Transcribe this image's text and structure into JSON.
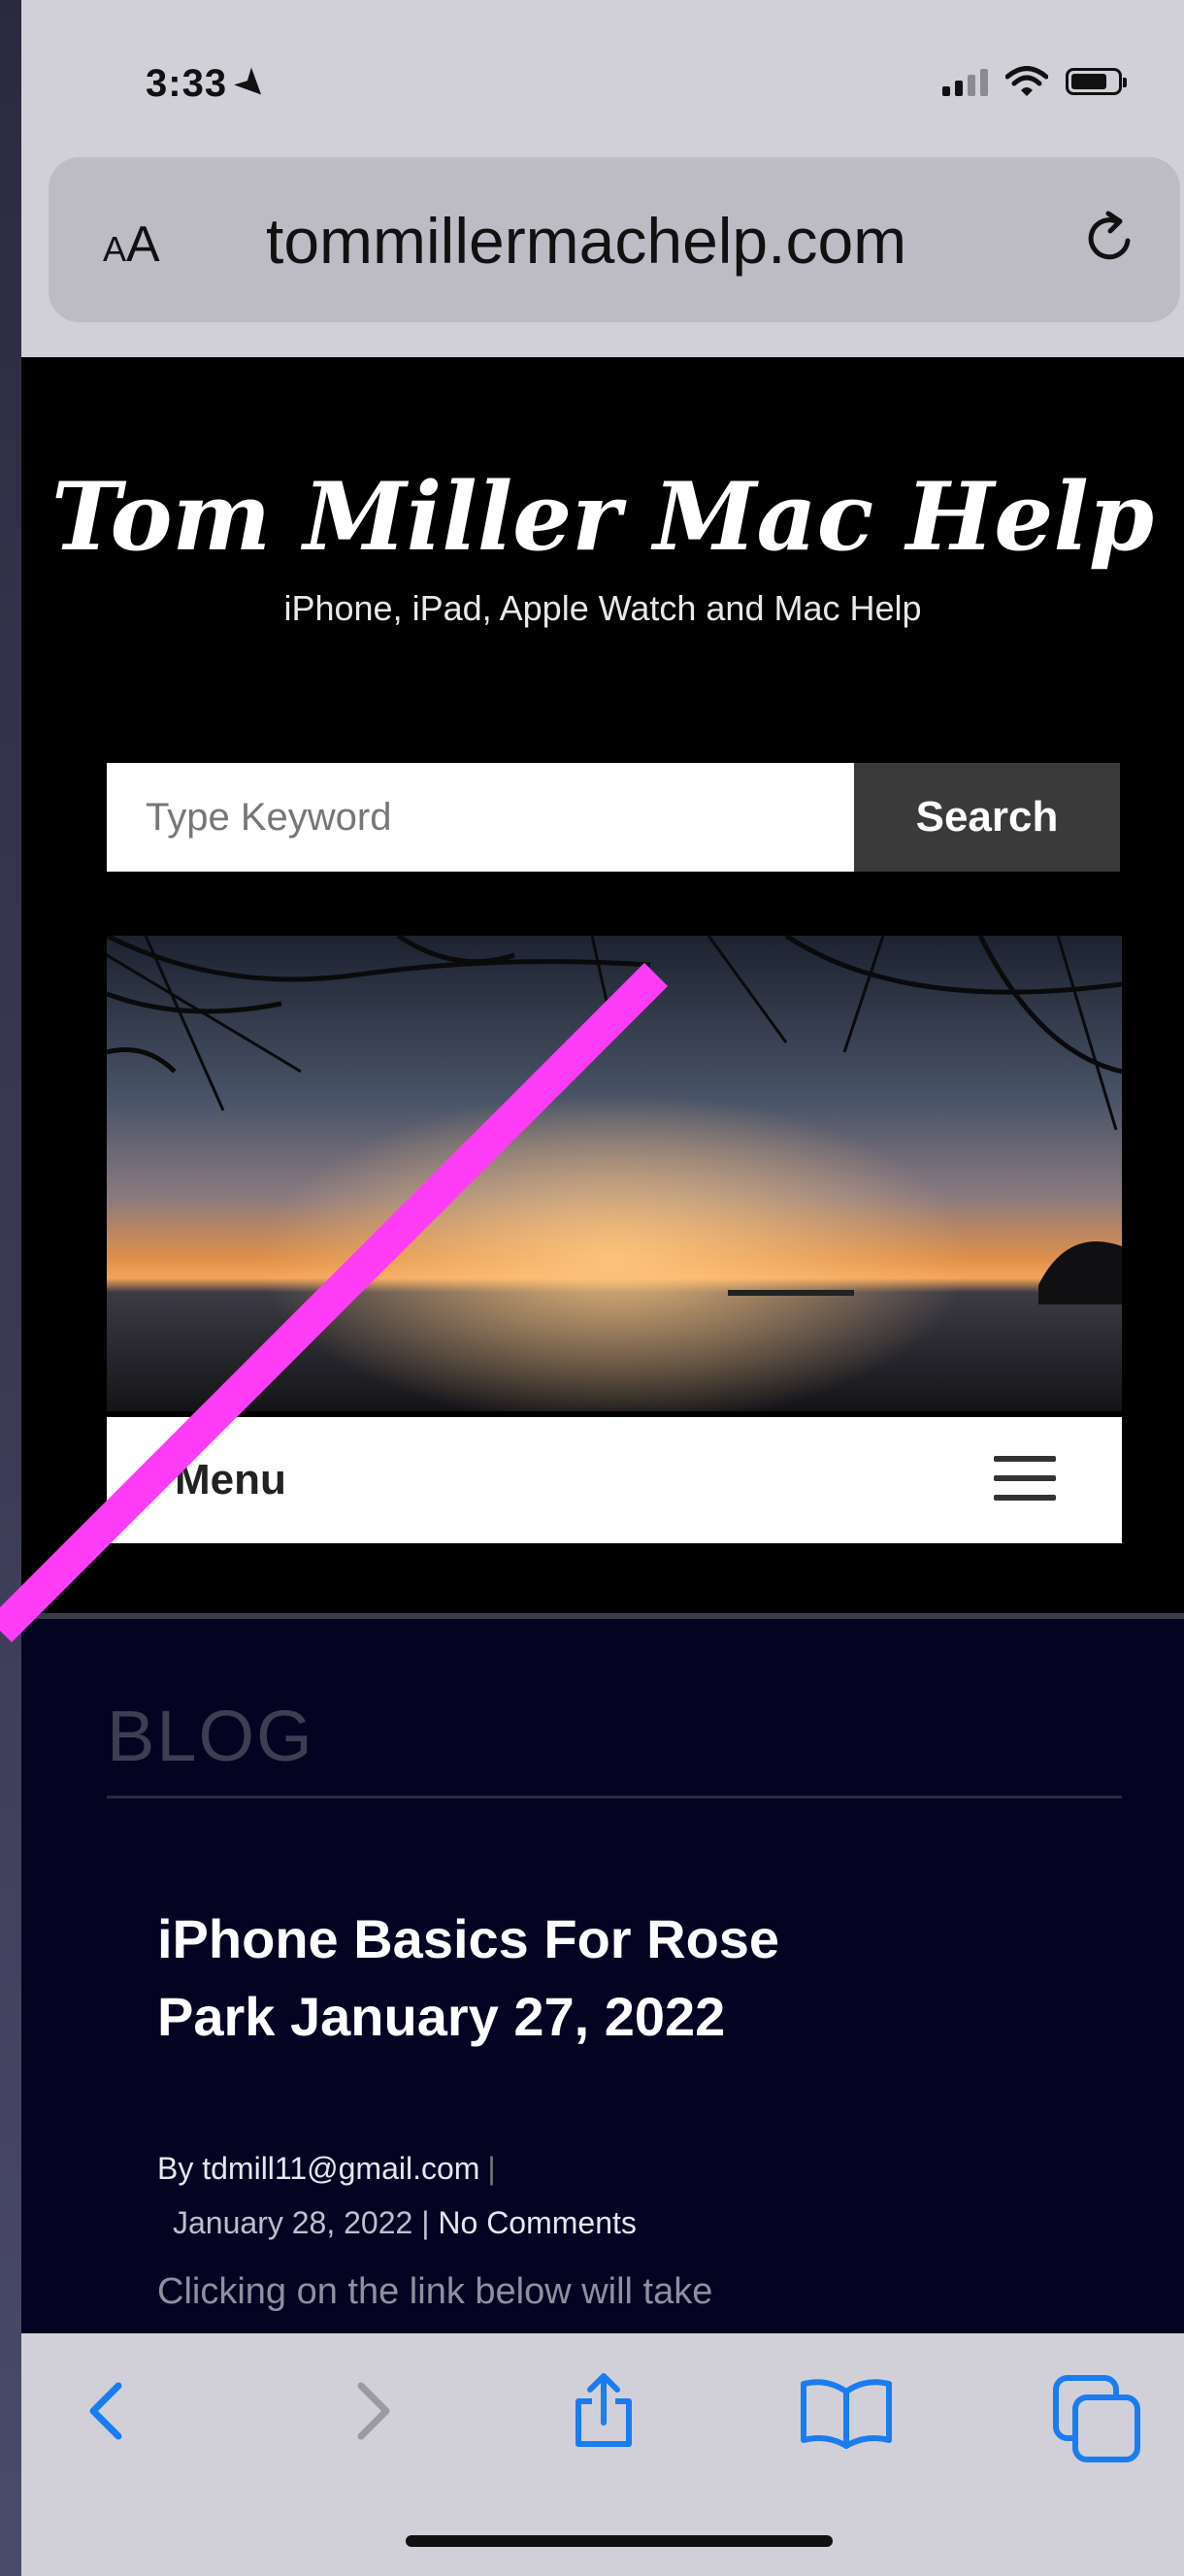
{
  "status_bar": {
    "time": "3:33"
  },
  "browser": {
    "aa_small": "A",
    "aa_large": "A",
    "url": "tommillermachelp.com"
  },
  "site": {
    "title": "Tom Miller Mac Help",
    "tagline": "iPhone, iPad, Apple Watch and Mac Help",
    "search_placeholder": "Type Keyword",
    "search_button": "Search",
    "menu_label": "Menu"
  },
  "blog": {
    "heading": "BLOG",
    "post": {
      "title": "iPhone Basics For Rose Park January 27, 2022",
      "author": "By tdmill11@gmail.com",
      "separator": "|",
      "date": "January 28, 2022",
      "date_separator": "|",
      "comments": "No Comments",
      "excerpt": "Clicking on the link below will take"
    }
  },
  "colors": {
    "accent_blue": "#1a7cf0",
    "annotation": "#ff3cf5"
  },
  "icons": [
    "location-arrow-icon",
    "signal-icon",
    "wifi-icon",
    "battery-icon",
    "reload-icon",
    "hamburger-icon",
    "back-icon",
    "forward-icon",
    "share-icon",
    "bookmarks-icon",
    "tabs-icon"
  ]
}
